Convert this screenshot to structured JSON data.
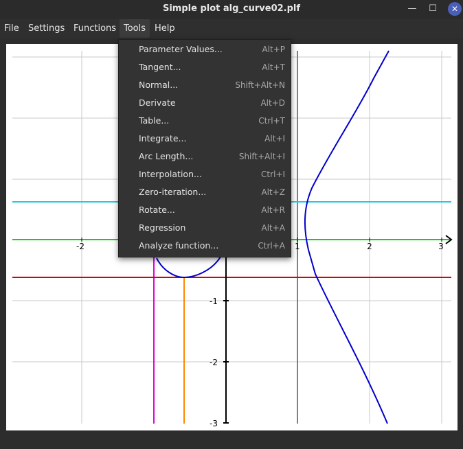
{
  "window": {
    "title": "Simple plot alg_curve02.plf",
    "minimize_glyph": "—",
    "maximize_glyph": "☐",
    "close_glyph": "✕"
  },
  "menubar": {
    "items": [
      "File",
      "Settings",
      "Functions",
      "Tools",
      "Help"
    ],
    "active": "Tools"
  },
  "tools_menu": {
    "items": [
      {
        "label": "Parameter Values...",
        "shortcut": "Alt+P"
      },
      {
        "label": "Tangent...",
        "shortcut": "Alt+T"
      },
      {
        "label": "Normal...",
        "shortcut": "Shift+Alt+N"
      },
      {
        "label": "Derivate",
        "shortcut": "Alt+D"
      },
      {
        "label": "Table...",
        "shortcut": "Ctrl+T"
      },
      {
        "label": "Integrate...",
        "shortcut": "Alt+I"
      },
      {
        "label": "Arc Length...",
        "shortcut": "Shift+Alt+I"
      },
      {
        "label": "Interpolation...",
        "shortcut": "Ctrl+I"
      },
      {
        "label": "Zero-iteration...",
        "shortcut": "Alt+Z"
      },
      {
        "label": "Rotate...",
        "shortcut": "Alt+R"
      },
      {
        "label": "Regression",
        "shortcut": "Alt+A"
      },
      {
        "label": "Analyze function...",
        "shortcut": "Ctrl+A"
      }
    ]
  },
  "plot": {
    "x_tick_labels": [
      "-2",
      "1",
      "2",
      "3"
    ],
    "y_tick_labels": [
      "-1",
      "-2",
      "-3"
    ],
    "colors": {
      "curve": "#0000cc",
      "x_axis": "#00dd00",
      "y_axis": "#000000",
      "cyan_line": "#22ccdd",
      "red_line": "#dd0000",
      "magenta_line": "#dd00dd",
      "orange_line": "#ff8800",
      "gray_line": "#808080",
      "grid": "#c8c8c8"
    }
  }
}
